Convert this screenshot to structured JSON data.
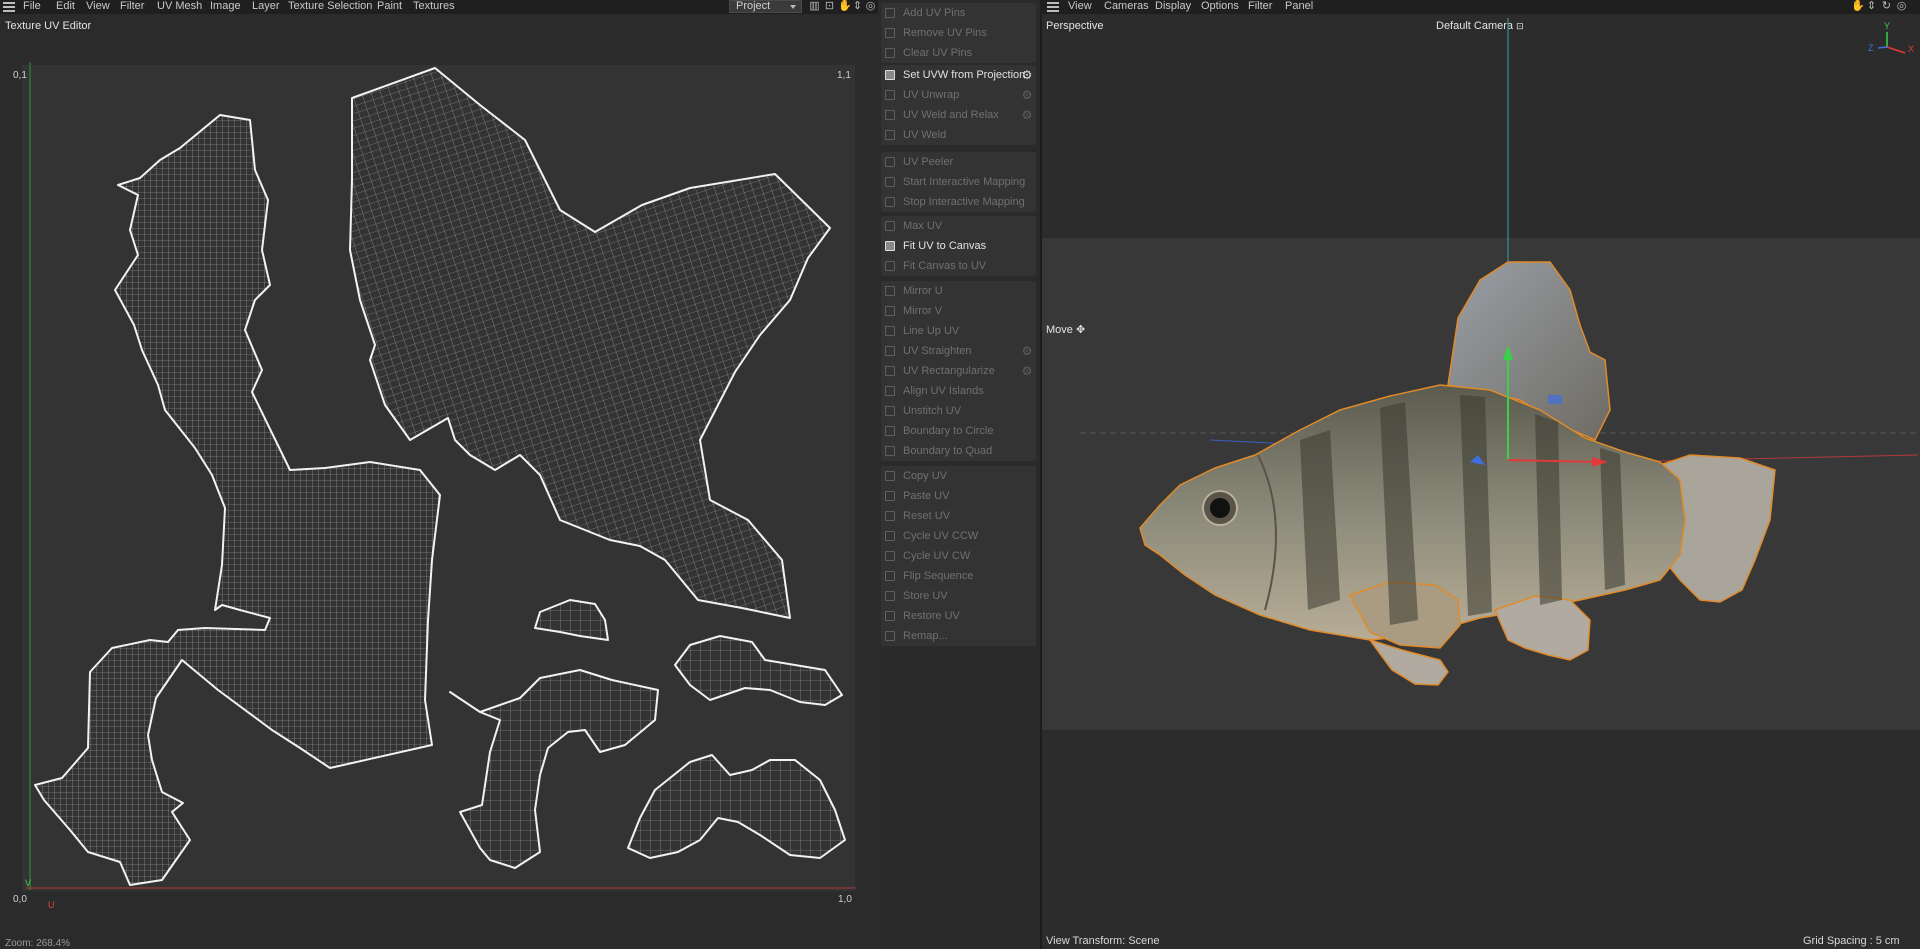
{
  "left_panel": {
    "menu": [
      "File",
      "Edit",
      "View",
      "Filter",
      "UV Mesh",
      "Image",
      "Layer",
      "Texture Selection",
      "Paint",
      "Textures"
    ],
    "project_select": "Project",
    "title": "Texture UV Editor",
    "corner_labels": {
      "top_left": "0,1",
      "top_right": "1,1",
      "bottom_left": "0,0",
      "bottom_right": "1,0",
      "axis_v": "V",
      "axis_u": "U"
    },
    "zoom_status": "Zoom: 268.4%"
  },
  "tools": {
    "groups": [
      {
        "items": [
          {
            "label": "Add UV Pins",
            "enabled": false,
            "gear": false
          },
          {
            "label": "Remove UV Pins",
            "enabled": false,
            "gear": false
          },
          {
            "label": "Clear UV Pins",
            "enabled": false,
            "gear": false
          }
        ]
      },
      {
        "items": [
          {
            "label": "Set UVW from Projection",
            "enabled": true,
            "gear": true
          },
          {
            "label": "UV Unwrap",
            "enabled": false,
            "gear": true
          },
          {
            "label": "UV Weld and Relax",
            "enabled": false,
            "gear": true
          },
          {
            "label": "UV Weld",
            "enabled": false,
            "gear": false
          }
        ]
      },
      {
        "items": [
          {
            "label": "UV Peeler",
            "enabled": false,
            "gear": false
          },
          {
            "label": "Start Interactive Mapping",
            "enabled": false,
            "gear": false
          },
          {
            "label": "Stop Interactive Mapping",
            "enabled": false,
            "gear": false
          }
        ]
      },
      {
        "items": [
          {
            "label": "Max UV",
            "enabled": false,
            "gear": false
          },
          {
            "label": "Fit UV to Canvas",
            "enabled": true,
            "gear": false
          },
          {
            "label": "Fit Canvas to UV",
            "enabled": false,
            "gear": false
          }
        ]
      },
      {
        "items": [
          {
            "label": "Mirror U",
            "enabled": false,
            "gear": false
          },
          {
            "label": "Mirror V",
            "enabled": false,
            "gear": false
          },
          {
            "label": "Line Up UV",
            "enabled": false,
            "gear": false
          },
          {
            "label": "UV Straighten",
            "enabled": false,
            "gear": true
          },
          {
            "label": "UV Rectangularize",
            "enabled": false,
            "gear": true
          },
          {
            "label": "Align UV Islands",
            "enabled": false,
            "gear": false
          },
          {
            "label": "Unstitch UV",
            "enabled": false,
            "gear": false
          },
          {
            "label": "Boundary to Circle",
            "enabled": false,
            "gear": false
          },
          {
            "label": "Boundary to Quad",
            "enabled": false,
            "gear": false
          }
        ]
      },
      {
        "items": [
          {
            "label": "Copy UV",
            "enabled": false,
            "gear": false
          },
          {
            "label": "Paste UV",
            "enabled": false,
            "gear": false
          },
          {
            "label": "Reset UV",
            "enabled": false,
            "gear": false
          },
          {
            "label": "Cycle UV CCW",
            "enabled": false,
            "gear": false
          },
          {
            "label": "Cycle UV CW",
            "enabled": false,
            "gear": false
          },
          {
            "label": "Flip Sequence",
            "enabled": false,
            "gear": false
          },
          {
            "label": "Store UV",
            "enabled": false,
            "gear": false
          },
          {
            "label": "Restore UV",
            "enabled": false,
            "gear": false
          },
          {
            "label": "Remap...",
            "enabled": false,
            "gear": false
          }
        ]
      }
    ]
  },
  "viewport": {
    "menu": [
      "View",
      "Cameras",
      "Display",
      "Options",
      "Filter",
      "Panel"
    ],
    "projection": "Perspective",
    "camera": "Default Camera",
    "tool_hint": "Move",
    "view_transform": "View Transform: Scene",
    "grid_spacing": "Grid Spacing : 5 cm",
    "axis_labels": {
      "y": "Y",
      "z": "Z",
      "x": "X"
    },
    "colors": {
      "axis_x": "#e23a3a",
      "axis_y": "#3ad14a",
      "axis_z": "#3f6fe0",
      "selection_outline": "#e08a2a"
    }
  }
}
